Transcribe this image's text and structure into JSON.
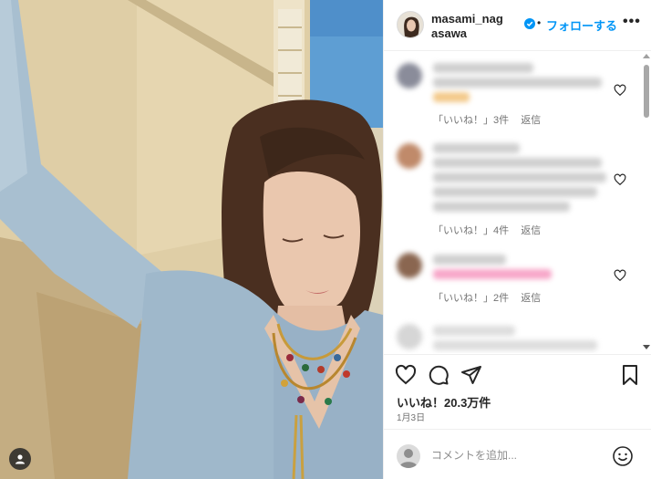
{
  "post": {
    "photo_alt": "post-photo",
    "profile_tag_icon": "person-icon"
  },
  "header": {
    "username": "masami_nagasawa",
    "verified_icon": "verified-badge-icon",
    "separator": "•",
    "follow_label": "フォローする",
    "more_icon": "more-options-icon",
    "more_label": "•••"
  },
  "comments": [
    {
      "likes_label": "「いいね！」3件",
      "reply_label": "返信",
      "avatar_color": "#8a8c9a",
      "accent_color": "#f3c98a"
    },
    {
      "likes_label": "「いいね！」4件",
      "reply_label": "返信",
      "avatar_color": "#c08a6a",
      "accent_color": ""
    },
    {
      "likes_label": "「いいね！」2件",
      "reply_label": "返信",
      "avatar_color": "#8a6650",
      "accent_color": "#f7a6c8"
    },
    {
      "likes_label": "",
      "reply_label": "",
      "avatar_color": "#cfcfcf",
      "accent_color": ""
    }
  ],
  "actions": {
    "like_icon": "heart-icon",
    "comment_icon": "comment-icon",
    "share_icon": "share-icon",
    "save_icon": "bookmark-icon",
    "likes_text": "いいね！20.3万件",
    "date_text": "1月3日"
  },
  "composer": {
    "placeholder": "コメントを追加...",
    "emoji_icon": "emoji-icon"
  },
  "colors": {
    "accent": "#0095f6",
    "text": "#262626",
    "muted": "#737373",
    "sky": "#5c9bd1",
    "wall": "#dcc9a1",
    "sweater": "#9fb6c9"
  }
}
